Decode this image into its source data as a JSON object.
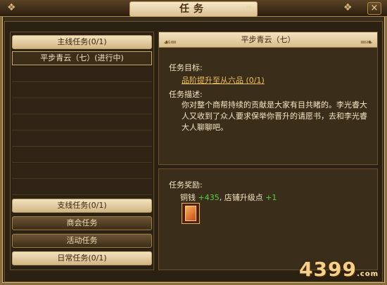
{
  "window": {
    "title": "任务",
    "close_icon": "×"
  },
  "sidebar": {
    "main_category": "主线任务(0/1)",
    "active_quest": "平步青云（七）(进行中)",
    "categories": [
      {
        "label": "支线任务(0/1)",
        "dark": false
      },
      {
        "label": "商会任务",
        "dark": true
      },
      {
        "label": "活动任务",
        "dark": true
      },
      {
        "label": "日常任务(0/1)",
        "dark": false
      }
    ]
  },
  "detail": {
    "quest_title": "平步青云（七）",
    "target_label": "任务目标:",
    "target_value": "品阶提升至从六品 (0/1)",
    "desc_label": "任务描述:",
    "description": "你对整个商帮持续的贡献是大家有目共睹的。李光睿大人又收到了众人要求保举你晋升的请愿书，去和李光睿大人聊聊吧。"
  },
  "reward": {
    "label": "任务奖励:",
    "copper_label": "铜钱",
    "copper_value": "+435",
    "separator": ",",
    "shop_label": "店铺升级点",
    "shop_value": "+1"
  },
  "watermark": {
    "text": "4399",
    "suffix": ".com"
  }
}
